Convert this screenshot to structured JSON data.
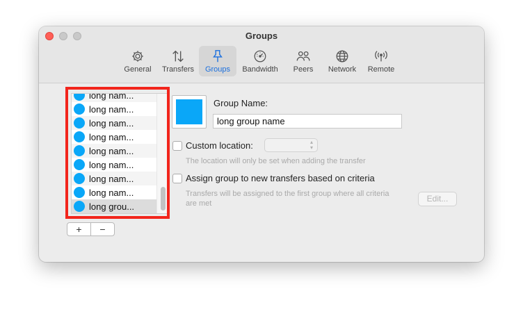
{
  "window": {
    "title": "Groups"
  },
  "toolbar": {
    "items": [
      {
        "label": "General",
        "icon": "gear-icon"
      },
      {
        "label": "Transfers",
        "icon": "transfer-arrows-icon"
      },
      {
        "label": "Groups",
        "icon": "pin-icon",
        "active": true
      },
      {
        "label": "Bandwidth",
        "icon": "gauge-icon"
      },
      {
        "label": "Peers",
        "icon": "people-icon"
      },
      {
        "label": "Network",
        "icon": "globe-icon"
      },
      {
        "label": "Remote",
        "icon": "antenna-icon"
      }
    ]
  },
  "groups_list": {
    "rows": [
      "long nam...",
      "long nam...",
      "long nam...",
      "long nam...",
      "long nam...",
      "long nam...",
      "long nam...",
      "long nam...",
      "long grou..."
    ],
    "selected_index": 8,
    "add_label": "+",
    "remove_label": "−"
  },
  "detail": {
    "group_name_label": "Group Name:",
    "group_name_value": "long group name",
    "custom_location_label": "Custom location:",
    "custom_location_hint": "The location will only be set when adding the transfer",
    "assign_label": "Assign group to new transfers based on criteria",
    "assign_hint_line1": "Transfers will be assigned to the first group where all criteria",
    "assign_hint_line2": "are met",
    "edit_label": "Edit..."
  },
  "colors": {
    "accent": "#1a6fde",
    "group_color": "#0aa7f8",
    "highlight": "#f2251c"
  }
}
